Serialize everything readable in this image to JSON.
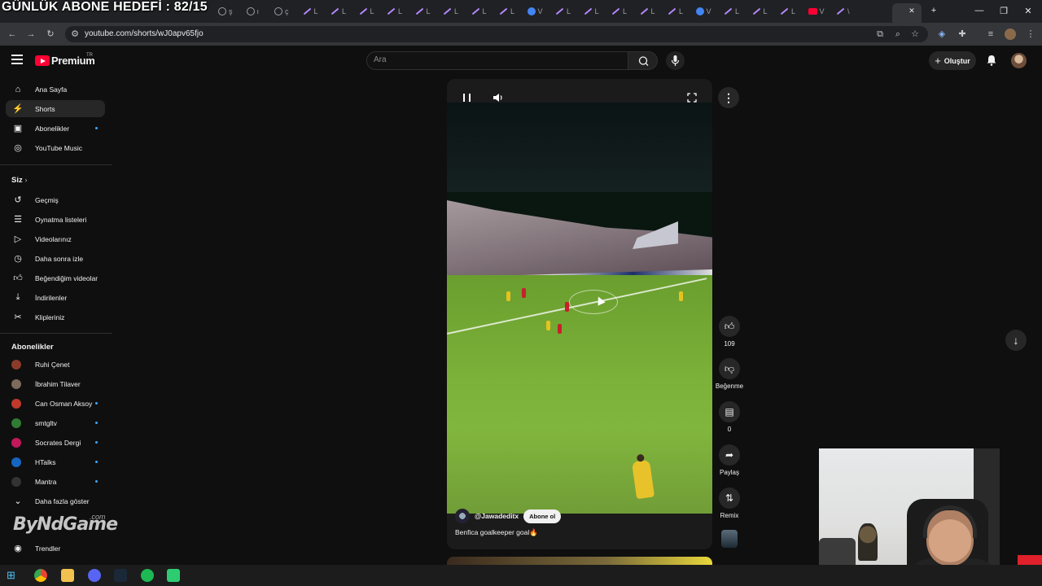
{
  "overlay": {
    "goal_text": "GÜNLÜK ABONE HEDEFİ : 82/15"
  },
  "browser": {
    "url": "youtube.com/shorts/wJ0apv65fjo",
    "tab_letters": [
      "ş",
      "ı",
      "ç",
      "L",
      "L",
      "L",
      "L",
      "L",
      "L",
      "L",
      "L",
      "V",
      "L",
      "L",
      "L",
      "L",
      "L",
      "V",
      "L",
      "L",
      "L",
      "V",
      "\\"
    ],
    "window_controls": {
      "minimize": "—",
      "maximize": "❐",
      "close": "✕"
    },
    "new_tab": "+",
    "close_tab": "✕"
  },
  "youtube": {
    "logo_text": "Premium",
    "country_code": "TR",
    "search_placeholder": "Ara",
    "create_label": "Oluştur"
  },
  "sidebar": {
    "main": [
      {
        "label": "Ana Sayfa",
        "icon": "home-icon"
      },
      {
        "label": "Shorts",
        "icon": "shorts-icon",
        "active": true
      },
      {
        "label": "Abonelikler",
        "icon": "subscriptions-icon",
        "dot": true
      },
      {
        "label": "YouTube Music",
        "icon": "music-icon"
      }
    ],
    "you_heading": "Siz",
    "you": [
      {
        "label": "Geçmiş",
        "icon": "history-icon"
      },
      {
        "label": "Oynatma listeleri",
        "icon": "playlists-icon"
      },
      {
        "label": "Videolarınız",
        "icon": "your-videos-icon"
      },
      {
        "label": "Daha sonra izle",
        "icon": "watch-later-icon"
      },
      {
        "label": "Beğendiğim videolar",
        "icon": "liked-videos-icon"
      },
      {
        "label": "İndirilenler",
        "icon": "downloads-icon"
      },
      {
        "label": "Klipleriniz",
        "icon": "clips-icon"
      }
    ],
    "subs_heading": "Abonelikler",
    "subscriptions": [
      {
        "label": "Ruhi Çenet",
        "color": "#8a3b2a",
        "dot": false
      },
      {
        "label": "İbrahim Tilaver",
        "color": "#7c6a5a",
        "dot": false
      },
      {
        "label": "Can Osman Aksoy",
        "color": "#c0392b",
        "dot": true
      },
      {
        "label": "smtgltv",
        "color": "#2e7d32",
        "dot": true
      },
      {
        "label": "Socrates Dergi",
        "color": "#c2185b",
        "dot": true
      },
      {
        "label": "HTalks",
        "color": "#1565c0",
        "dot": true
      },
      {
        "label": "Mantra",
        "color": "#333333",
        "dot": true
      }
    ],
    "show_more": "Daha fazla göster",
    "trending": "Trendler",
    "watermark": "ByNdGame",
    "watermark_suffix": ".com"
  },
  "short": {
    "channel": "@Jawadeditx",
    "subscribe_label": "Abone ol",
    "title": "Benfica goalkeeper goal🔥"
  },
  "actions": {
    "like_count": "109",
    "dislike_label": "Beğenme",
    "comment_count": "0",
    "share_label": "Paylaş",
    "remix_label": "Remix"
  },
  "colors": {
    "brand_red": "#ff0033",
    "background": "#0f0f0f",
    "accent_blue": "#3ea6ff"
  }
}
